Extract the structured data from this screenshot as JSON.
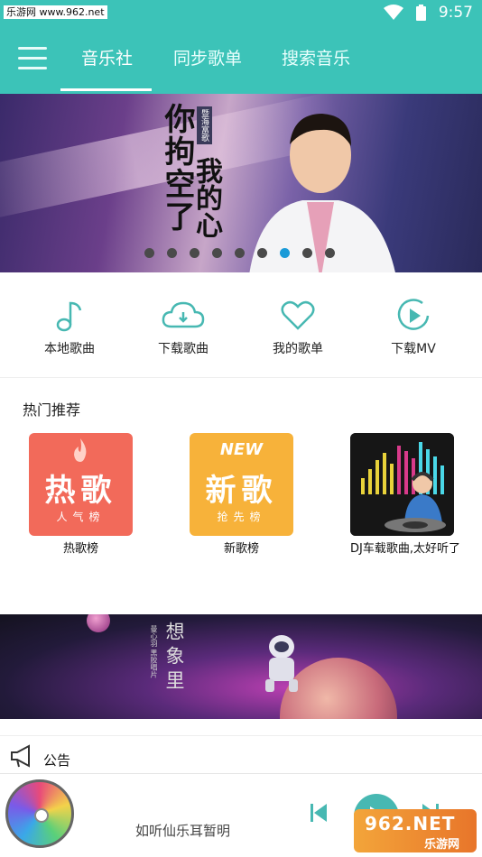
{
  "status": {
    "watermark": "乐游网 www.962.net",
    "time": "9:57"
  },
  "nav": {
    "tabs": [
      {
        "label": "音乐社"
      },
      {
        "label": "同步歌单"
      },
      {
        "label": "搜索音乐"
      }
    ]
  },
  "banner": {
    "title_line1": "你拘空了",
    "title_line2": "我的心",
    "tag": "暨海富歌",
    "dots": 9,
    "active_dot": 7
  },
  "quick": {
    "items": [
      {
        "label": "本地歌曲",
        "icon": "music-note-icon"
      },
      {
        "label": "下载歌曲",
        "icon": "cloud-download-icon"
      },
      {
        "label": "我的歌单",
        "icon": "heart-icon"
      },
      {
        "label": "下载MV",
        "icon": "play-circle-icon"
      }
    ]
  },
  "hot": {
    "title": "热门推荐",
    "cards": [
      {
        "big": "热歌",
        "small": "人气榜",
        "caption": "热歌榜",
        "color": "#f26a5a"
      },
      {
        "big": "新歌",
        "small": "抢先榜",
        "badge": "NEW",
        "caption": "新歌榜",
        "color": "#f7b23a"
      },
      {
        "caption": "DJ车载歌曲,太好听了"
      }
    ]
  },
  "space_banner": {
    "text": "想象里",
    "small": "曼心羽 黑胶唱片"
  },
  "notice": {
    "label": "公告"
  },
  "player": {
    "song": "如听仙乐耳暂明"
  },
  "watermark_bottom": {
    "text": "962.NET",
    "sub": "乐游网"
  },
  "colors": {
    "primary": "#3cc3b8",
    "accent": "#47b8b2"
  }
}
